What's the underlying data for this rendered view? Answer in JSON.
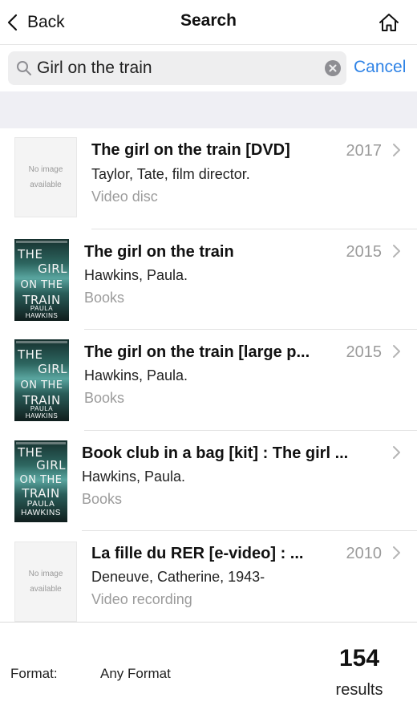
{
  "nav": {
    "back_label": "Back",
    "title": "Search",
    "home_icon": "home-icon"
  },
  "search": {
    "value": "Girl on the train",
    "cancel_label": "Cancel"
  },
  "no_image_text": "No image available",
  "results": [
    {
      "title": "The girl on the train [DVD]",
      "author": "Taylor, Tate, film director.",
      "format": "Video disc",
      "year": "2017",
      "thumbnail": "no-image"
    },
    {
      "title": "The girl on the train",
      "author": "Hawkins, Paula.",
      "format": "Books",
      "year": "2015",
      "thumbnail": "cover"
    },
    {
      "title": "The girl on the train [large p...",
      "author": "Hawkins, Paula.",
      "format": "Books",
      "year": "2015",
      "thumbnail": "cover"
    },
    {
      "title": "Book club in a bag [kit] : The girl ...",
      "author": "Hawkins, Paula.",
      "format": "Books",
      "year": "",
      "thumbnail": "cover"
    },
    {
      "title": "La fille du RER [e-video] : ...",
      "author": "Deneuve, Catherine, 1943-",
      "format": "Video recording",
      "year": "2010",
      "thumbnail": "no-image"
    }
  ],
  "cover_art": {
    "lines": [
      "THE",
      "GIRL",
      "ON THE",
      "TRAIN"
    ],
    "author": "PAULA HAWKINS"
  },
  "footer": {
    "format_label": "Format:",
    "format_value": "Any Format",
    "count": "154",
    "results_label": "results"
  },
  "colors": {
    "accent": "#2f83e6",
    "muted_text": "#9b9b9b",
    "band_background": "#efeff4"
  }
}
